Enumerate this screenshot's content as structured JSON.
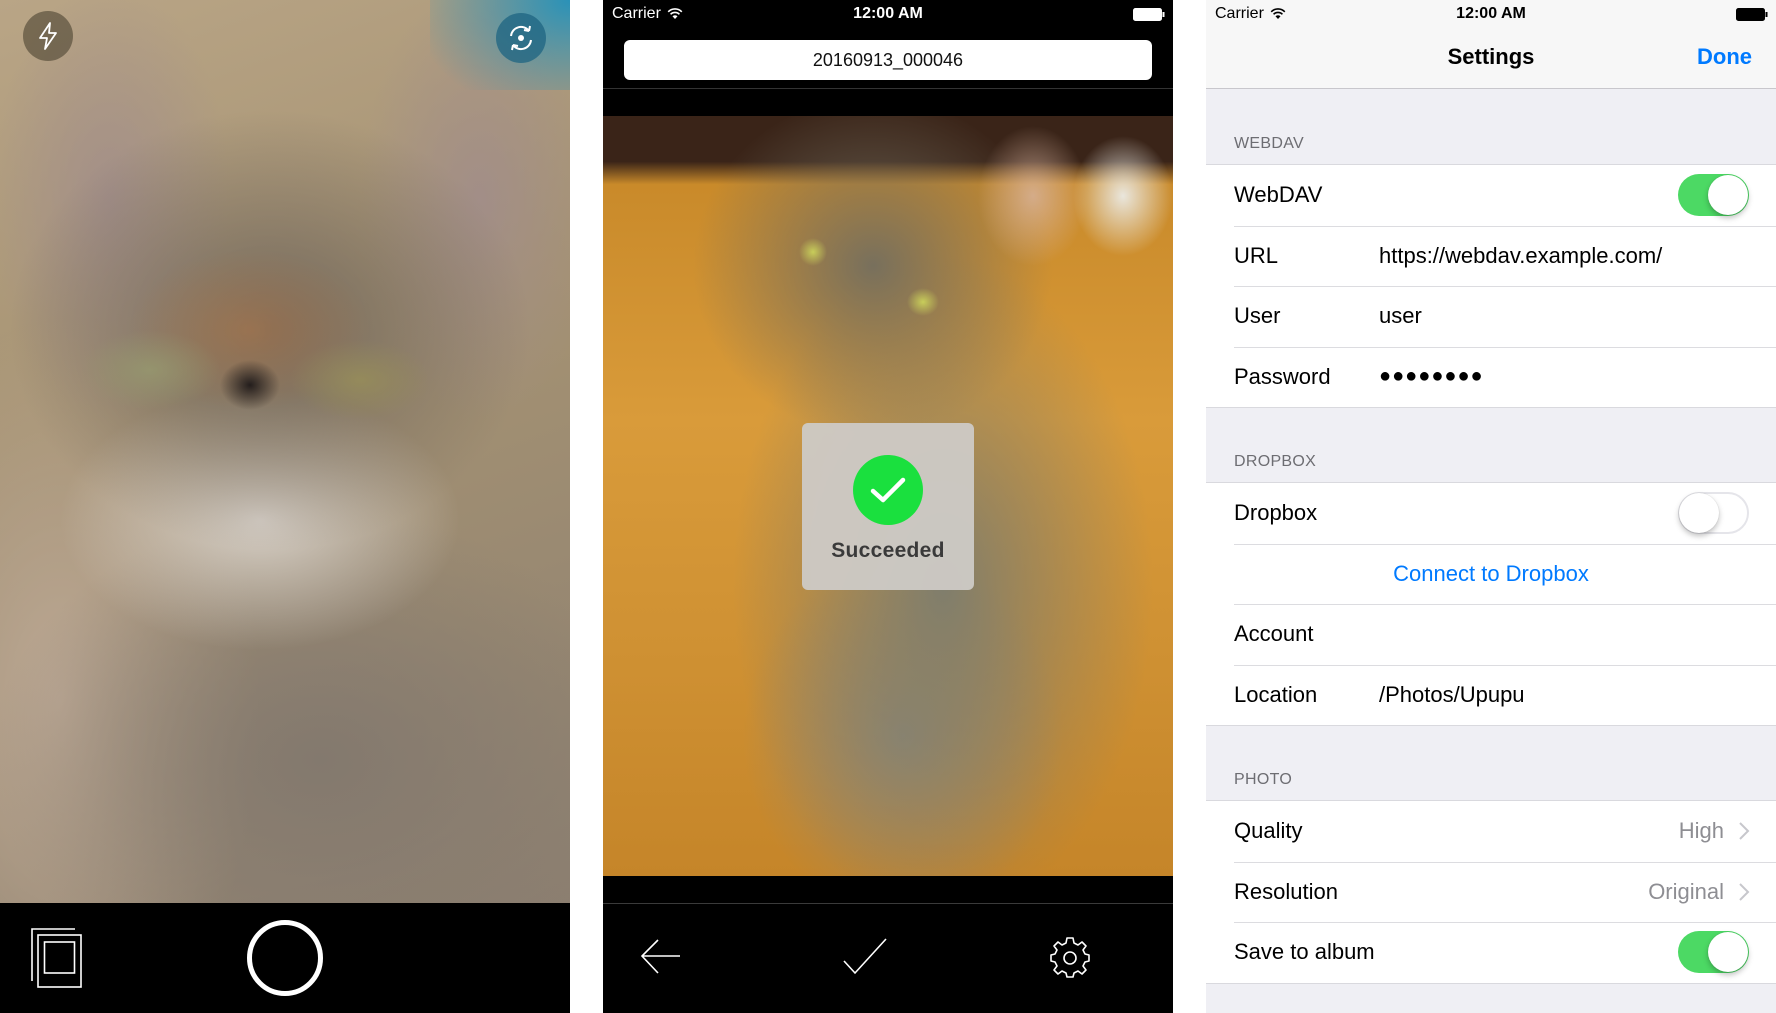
{
  "camera_screen": {
    "flash_icon": "flash-icon",
    "switch_camera_icon": "switch-camera-icon",
    "gallery_icon": "gallery-icon",
    "shutter_icon": "shutter-icon"
  },
  "preview_screen": {
    "status_bar": {
      "carrier": "Carrier",
      "time": "12:00 AM"
    },
    "filename": "20160913_000046",
    "hud": {
      "icon": "checkmark-circle-icon",
      "text": "Succeeded",
      "color": "#1ae03e"
    },
    "toolbar": {
      "back_icon": "back-arrow-icon",
      "confirm_icon": "checkmark-icon",
      "settings_icon": "gear-icon"
    }
  },
  "settings_screen": {
    "status_bar": {
      "carrier": "Carrier",
      "time": "12:00 AM"
    },
    "title": "Settings",
    "done_label": "Done",
    "accent_color": "#007aff",
    "sections": {
      "webdav": {
        "header": "WEBDAV",
        "rows": {
          "toggle": {
            "label": "WebDAV",
            "on": true
          },
          "url": {
            "label": "URL",
            "value": "https://webdav.example.com/"
          },
          "user": {
            "label": "User",
            "value": "user"
          },
          "password": {
            "label": "Password",
            "value": "●●●●●●●●"
          }
        }
      },
      "dropbox": {
        "header": "DROPBOX",
        "rows": {
          "toggle": {
            "label": "Dropbox",
            "on": false
          },
          "connect": {
            "label": "Connect to Dropbox"
          },
          "account": {
            "label": "Account",
            "value": ""
          },
          "location": {
            "label": "Location",
            "value": "/Photos/Upupu"
          }
        }
      },
      "photo": {
        "header": "PHOTO",
        "rows": {
          "quality": {
            "label": "Quality",
            "value": "High"
          },
          "resolution": {
            "label": "Resolution",
            "value": "Original"
          },
          "save_to_album": {
            "label": "Save to album",
            "on": true
          }
        }
      }
    }
  }
}
